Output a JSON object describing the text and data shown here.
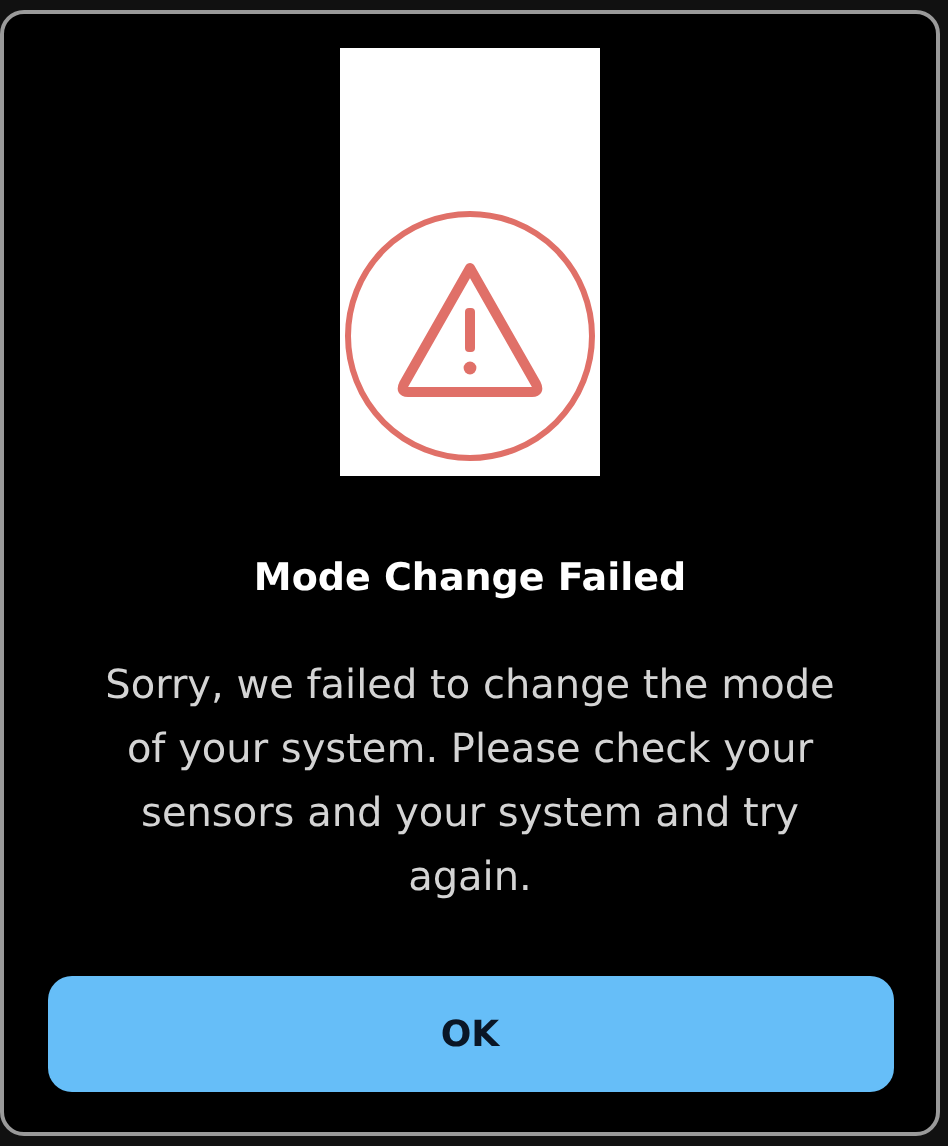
{
  "dialog": {
    "title": "Mode Change Failed",
    "message": "Sorry, we failed to change the mode of your system. Please check your sensors and your system and try again.",
    "buttons": [
      "OK"
    ]
  }
}
